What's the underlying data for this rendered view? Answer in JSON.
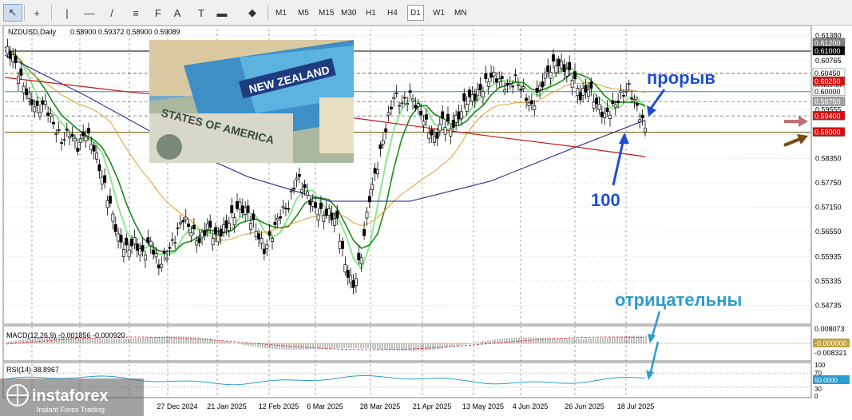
{
  "toolbar": {
    "tools": [
      "cursor-icon",
      "crosshair-icon",
      "vertical-line-icon",
      "horizontal-line-icon",
      "trend-line-icon",
      "fibonacci-icon",
      "fibonacci-fan-icon",
      "text-icon",
      "text-label-icon",
      "rectangle-icon",
      "shapes-dropdown-icon"
    ],
    "timeframes": [
      "M1",
      "M5",
      "M15",
      "M30",
      "H1",
      "H4",
      "D1",
      "W1",
      "MN"
    ],
    "active_timeframe": "D1"
  },
  "chart_header": {
    "symbol_label": "NZDUSD,Daily",
    "ohlc": "0.58900 0.59372 0.58900 0.59089"
  },
  "annotations": {
    "breakout": "прорыв",
    "ma_period": "100",
    "negative": "отрицательны"
  },
  "logo": {
    "brand": "instaforex",
    "tagline": "Instant Forex Trading"
  },
  "indicators": {
    "macd_label": "MACD(12,26,9) -0.001856 -0.000920",
    "macd_axis": [
      "0.008073",
      "-0.000000",
      "-0.008321"
    ],
    "rsi_label": "RSI(14) 38.8967",
    "rsi_axis": [
      "100",
      "70",
      "50.0000",
      "30",
      "0"
    ]
  },
  "colors": {
    "candle": "#000000",
    "ema_fast": "#1a8a1a",
    "ema_light": "#8ee68e",
    "sma_200": "#c01818",
    "sma_100": "#1a1a8c",
    "sma_50": "#e0a030",
    "annotation_blue": "#1f4fcf",
    "annotation_cyan": "#2c9bd0",
    "arrow_red": "#c07070",
    "arrow_brown": "#7a4a10"
  },
  "chart_data": {
    "type": "candlestick",
    "title": "NZDUSD,Daily",
    "ylim": [
      0.5435,
      0.6155
    ],
    "price_ticks": [
      "0.61380",
      "0.60765",
      "0.60150",
      "0.59555",
      "0.58950",
      "0.58350",
      "0.57750",
      "0.57150",
      "0.56550",
      "0.55935",
      "0.55335",
      "0.54735"
    ],
    "price_labels": [
      {
        "text": "0.61200",
        "value": 0.612,
        "bg": "#808080",
        "fg": "#ffffff"
      },
      {
        "text": "0.61000",
        "value": 0.61,
        "bg": "#000000",
        "fg": "#ffffff"
      },
      {
        "text": "0.60450",
        "value": 0.6045,
        "bg": "#ffffff",
        "fg": "#000000"
      },
      {
        "text": "0.60250",
        "value": 0.6025,
        "bg": "#d01010",
        "fg": "#ffffff"
      },
      {
        "text": "0.60000",
        "value": 0.6,
        "bg": "#ffffff",
        "fg": "#000000"
      },
      {
        "text": "0.59750",
        "value": 0.5975,
        "bg": "#a0a0a0",
        "fg": "#ffffff"
      },
      {
        "text": "0.59400",
        "value": 0.594,
        "bg": "#d01010",
        "fg": "#ffffff"
      },
      {
        "text": "0.59000",
        "value": 0.59,
        "bg": "#d01010",
        "fg": "#ffffff"
      }
    ],
    "horizontal_levels": [
      {
        "value": 0.61,
        "color": "#000000",
        "dash": false
      },
      {
        "value": 0.6045,
        "color": "#a05050",
        "dash": true
      },
      {
        "value": 0.6,
        "color": "#2a8ac0",
        "dash": false
      },
      {
        "value": 0.5975,
        "color": "#a0a0a0",
        "dash": true
      },
      {
        "value": 0.594,
        "color": "#888888",
        "dash": true
      },
      {
        "value": 0.59,
        "color": "#6a5000",
        "dash": false
      }
    ],
    "date_labels": [
      "27 Dec 2024",
      "21 Jan 2025",
      "12 Feb 2025",
      "6 Mar 2025",
      "28 Mar 2025",
      "21 Apr 2025",
      "13 May 2025",
      "4 Jun 2025",
      "26 Jun 2025",
      "18 Jul 2025"
    ],
    "close_path": [
      [
        0,
        0.611
      ],
      [
        4,
        0.6085
      ],
      [
        8,
        0.603
      ],
      [
        12,
        0.5985
      ],
      [
        16,
        0.5955
      ],
      [
        20,
        0.597
      ],
      [
        24,
        0.592
      ],
      [
        28,
        0.588
      ],
      [
        32,
        0.59
      ],
      [
        36,
        0.5865
      ],
      [
        40,
        0.59
      ],
      [
        44,
        0.586
      ],
      [
        48,
        0.579
      ],
      [
        52,
        0.572
      ],
      [
        56,
        0.564
      ],
      [
        60,
        0.561
      ],
      [
        64,
        0.563
      ],
      [
        68,
        0.56
      ],
      [
        72,
        0.563
      ],
      [
        76,
        0.557
      ],
      [
        80,
        0.56
      ],
      [
        84,
        0.564
      ],
      [
        88,
        0.569
      ],
      [
        92,
        0.566
      ],
      [
        96,
        0.563
      ],
      [
        100,
        0.567
      ],
      [
        104,
        0.564
      ],
      [
        108,
        0.566
      ],
      [
        112,
        0.569
      ],
      [
        116,
        0.572
      ],
      [
        120,
        0.57
      ],
      [
        124,
        0.566
      ],
      [
        128,
        0.561
      ],
      [
        132,
        0.565
      ],
      [
        136,
        0.57
      ],
      [
        140,
        0.572
      ],
      [
        144,
        0.579
      ],
      [
        148,
        0.576
      ],
      [
        152,
        0.572
      ],
      [
        156,
        0.57
      ],
      [
        160,
        0.57
      ],
      [
        164,
        0.568
      ],
      [
        168,
        0.557
      ],
      [
        172,
        0.552
      ],
      [
        176,
        0.56
      ],
      [
        180,
        0.574
      ],
      [
        184,
        0.582
      ],
      [
        188,
        0.591
      ],
      [
        192,
        0.599
      ],
      [
        196,
        0.597
      ],
      [
        200,
        0.599
      ],
      [
        204,
        0.596
      ],
      [
        208,
        0.592
      ],
      [
        212,
        0.588
      ],
      [
        216,
        0.593
      ],
      [
        220,
        0.591
      ],
      [
        224,
        0.594
      ],
      [
        228,
        0.598
      ],
      [
        232,
        0.599
      ],
      [
        236,
        0.601
      ],
      [
        240,
        0.604
      ],
      [
        244,
        0.603
      ],
      [
        248,
        0.601
      ],
      [
        252,
        0.603
      ],
      [
        256,
        0.6
      ],
      [
        260,
        0.596
      ],
      [
        264,
        0.601
      ],
      [
        268,
        0.605
      ],
      [
        272,
        0.607
      ],
      [
        276,
        0.606
      ],
      [
        280,
        0.604
      ],
      [
        284,
        0.599
      ],
      [
        288,
        0.601
      ],
      [
        292,
        0.597
      ],
      [
        296,
        0.594
      ],
      [
        300,
        0.596
      ],
      [
        304,
        0.599
      ],
      [
        308,
        0.601
      ],
      [
        312,
        0.596
      ],
      [
        316,
        0.5909
      ]
    ]
  }
}
